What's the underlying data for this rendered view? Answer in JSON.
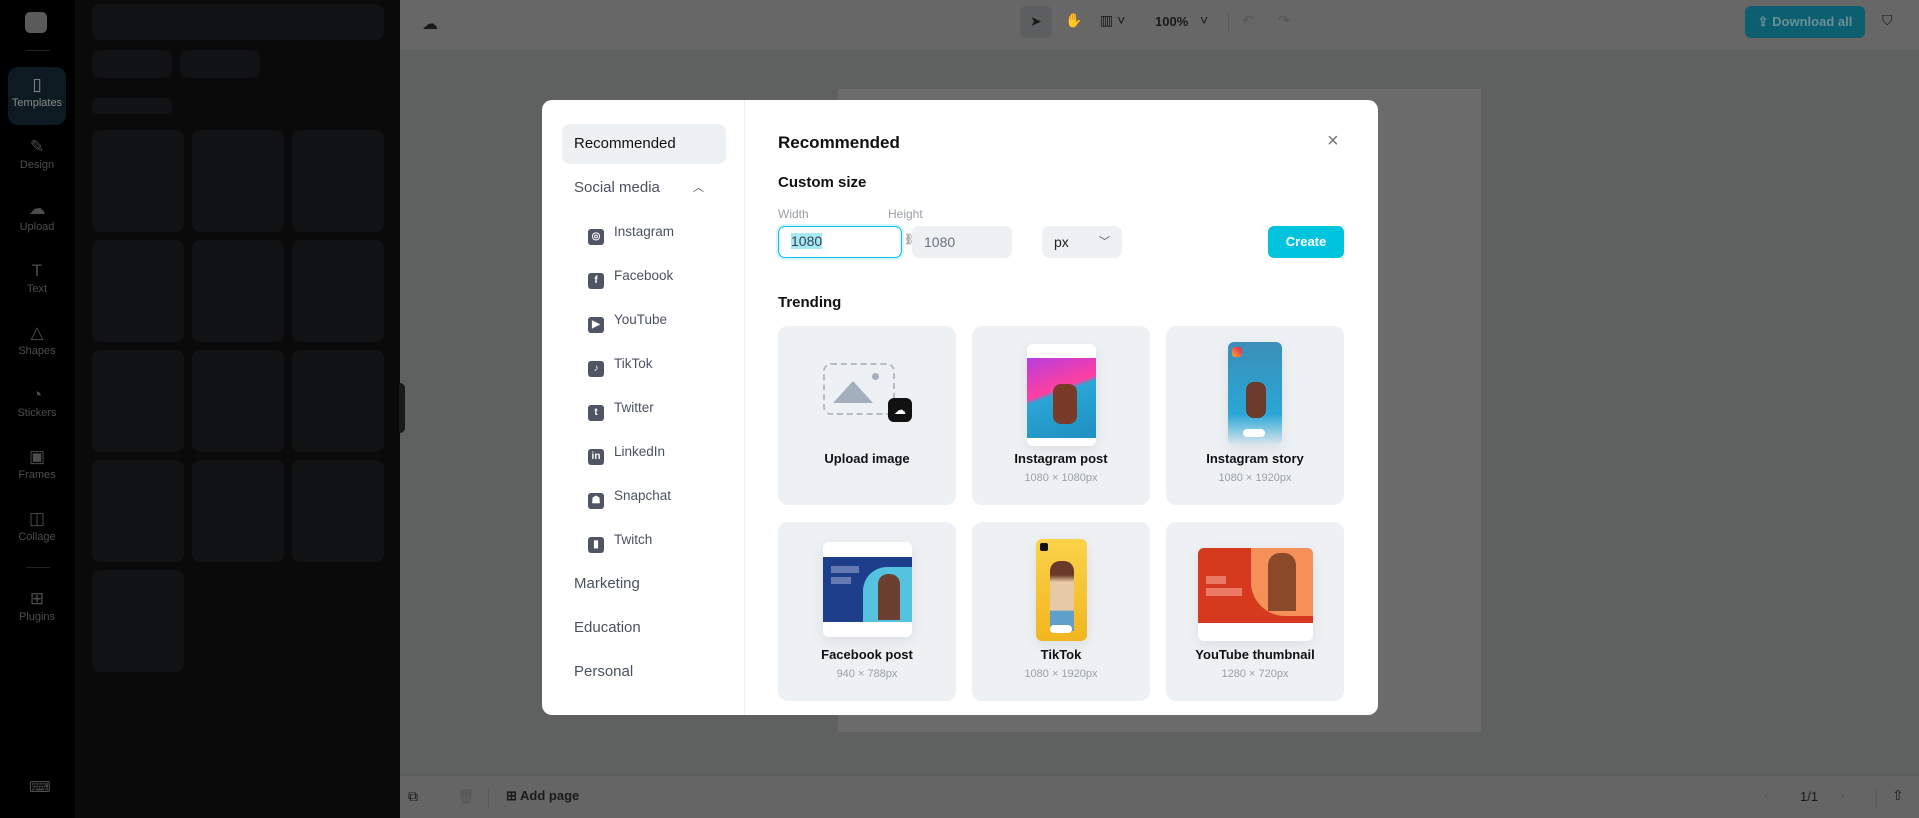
{
  "rail": {
    "items": [
      {
        "label": "Templates",
        "icon": "templates-icon",
        "glyph": "▯"
      },
      {
        "label": "Design",
        "icon": "design-icon",
        "glyph": "✎"
      },
      {
        "label": "Upload",
        "icon": "upload-cloud-icon",
        "glyph": "☁"
      },
      {
        "label": "Text",
        "icon": "text-icon",
        "glyph": "T"
      },
      {
        "label": "Shapes",
        "icon": "shapes-icon",
        "glyph": "△"
      },
      {
        "label": "Stickers",
        "icon": "stickers-icon",
        "glyph": "◔"
      },
      {
        "label": "Frames",
        "icon": "frames-icon",
        "glyph": "▣"
      },
      {
        "label": "Collage",
        "icon": "collage-icon",
        "glyph": "◫"
      },
      {
        "label": "Plugins",
        "icon": "plugins-icon",
        "glyph": "⊞"
      }
    ]
  },
  "toolbar": {
    "zoom": "100%",
    "download_label": "Download all"
  },
  "bottom": {
    "add_page": "Add page",
    "page_indicator": "1/1"
  },
  "modal": {
    "nav": {
      "recommended": "Recommended",
      "social_media": "Social media",
      "social_items": [
        "Instagram",
        "Facebook",
        "YouTube",
        "TikTok",
        "Twitter",
        "LinkedIn",
        "Snapchat",
        "Twitch"
      ],
      "social_glyphs": [
        "◎",
        "f",
        "▶",
        "♪",
        "t",
        "in",
        "☗",
        "▮"
      ],
      "marketing": "Marketing",
      "education": "Education",
      "personal": "Personal"
    },
    "title": "Recommended",
    "custom_size": "Custom size",
    "width_label": "Width",
    "width_value": "1080",
    "height_label": "Height",
    "height_value": "1080",
    "unit": "px",
    "create_label": "Create",
    "trending": "Trending",
    "cards": [
      {
        "title": "Upload image",
        "size": ""
      },
      {
        "title": "Instagram post",
        "size": "1080 × 1080px"
      },
      {
        "title": "Instagram story",
        "size": "1080 × 1920px"
      },
      {
        "title": "Facebook post",
        "size": "940 × 788px"
      },
      {
        "title": "TikTok",
        "size": "1080 × 1920px"
      },
      {
        "title": "YouTube thumbnail",
        "size": "1280 × 720px"
      }
    ]
  },
  "colors": {
    "accent": "#00c4dd",
    "accent_dimmed": "#0b5f6e"
  }
}
